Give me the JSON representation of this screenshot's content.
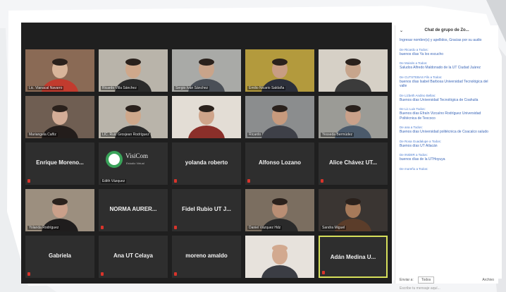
{
  "chat": {
    "title": "Chat de grupo de Zo...",
    "messages": [
      {
        "from": "",
        "text": "Ingresar nombre(s) y apellidos, Gracias por su audio"
      },
      {
        "from": "De Ricardo a Todos:",
        "text": "buenos días Ya los escucho"
      },
      {
        "from": "De Moisés a Todos:",
        "text": "Saludos Alfredo Maldonado de la UT Ciudad Juárez"
      },
      {
        "from": "De CUTSTEBAS Fils a Todos:",
        "text": "buenos días Isabel Barbosa Universidad Tecnológica del valle"
      },
      {
        "from": "De Lizbeth Andino Bellas:",
        "text": "Buenos días Universidad Tecnológica de Coahuila"
      },
      {
        "from": "De Lic Luis Todos:",
        "text": "Buenos días Efraín Vizcaíno Rodríguez Universidad Politécnica de Texcoco"
      },
      {
        "from": "De ana a Todos:",
        "text": "Buenos días Universidad politécnica de Coacalco saludo"
      },
      {
        "from": "De Rosa Guadalupe a Todos:",
        "text": "Buenos días UT Atlacán"
      },
      {
        "from": "De INIDIIR a Todos:",
        "text": "buenos días de la UTHoyuya"
      },
      {
        "from": "De moreño a Todos:",
        "text": ""
      }
    ],
    "send_to_label": "Enviar a:",
    "send_to_value": "Todos",
    "file_label": "Archivo",
    "input_placeholder": "Escribe tu mensaje aquí..."
  },
  "tiles": [
    {
      "type": "video",
      "caption": "Lic. Vianacal Navarro",
      "scene": "red"
    },
    {
      "type": "video",
      "caption": "Ricardo Villa Sánchez",
      "scene": "office"
    },
    {
      "type": "video",
      "caption": "Sergio Iván Sánchez",
      "scene": "grey"
    },
    {
      "type": "video",
      "caption": "Emilio Nicario Saldaña",
      "scene": "yellow"
    },
    {
      "type": "video",
      "caption": "",
      "scene": "room"
    },
    {
      "type": "video",
      "caption": "Mariangela Cañiz",
      "scene": "woman"
    },
    {
      "type": "video",
      "caption": "LIC. Ruiz Grosjean Rodríguez",
      "scene": "office"
    },
    {
      "type": "video",
      "caption": "",
      "scene": "white"
    },
    {
      "type": "video",
      "caption": "Ricardo",
      "scene": "man"
    },
    {
      "type": "video",
      "caption": "Yesseda Bermúdez",
      "scene": "man2"
    },
    {
      "type": "name",
      "name": "Enrique Moreno..."
    },
    {
      "type": "logo",
      "name": "VisiCom",
      "sub": "Estudio Virtual",
      "caption": "Edith Vázquez"
    },
    {
      "type": "name",
      "name": "yolanda roberto"
    },
    {
      "type": "name",
      "name": "Alfonso Lozano"
    },
    {
      "type": "name",
      "name": "Alice Chávez UT..."
    },
    {
      "type": "video",
      "caption": "Yolanda Rodríguez",
      "scene": "woman2"
    },
    {
      "type": "name",
      "name": "NORMA AURER..."
    },
    {
      "type": "name",
      "name": "Fidel Rubio UT J..."
    },
    {
      "type": "video",
      "caption": "Daniel Vázquez Hdz",
      "scene": "man3"
    },
    {
      "type": "video",
      "caption": "Sandra Miguel",
      "scene": "dark"
    },
    {
      "type": "name",
      "name": "Gabriela"
    },
    {
      "type": "name",
      "name": "Ana UT Celaya"
    },
    {
      "type": "name",
      "name": "moreno amaldo"
    },
    {
      "type": "video",
      "caption": "",
      "scene": "bald"
    },
    {
      "type": "name",
      "name": "Adán Medina U...",
      "active": true
    }
  ]
}
